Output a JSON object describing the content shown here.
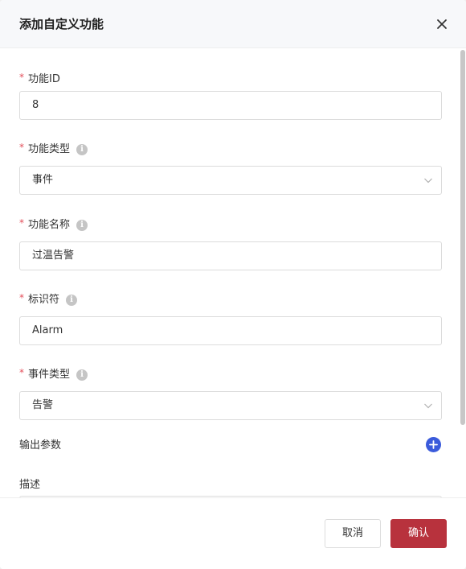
{
  "dialog": {
    "title": "添加自定义功能",
    "close_icon": "close-icon"
  },
  "form": {
    "required_mark": "*",
    "info_glyph": "i",
    "function_id": {
      "label": "功能ID",
      "value": "8"
    },
    "function_type": {
      "label": "功能类型",
      "value": "事件"
    },
    "function_name": {
      "label": "功能名称",
      "value": "过温告警"
    },
    "identifier": {
      "label": "标识符",
      "value": "Alarm"
    },
    "event_type": {
      "label": "事件类型",
      "value": "告警"
    },
    "output_params": {
      "label": "输出参数"
    },
    "description": {
      "label": "描述"
    }
  },
  "footer": {
    "cancel_label": "取消",
    "confirm_label": "确认"
  },
  "colors": {
    "primary": "#3b5bdb",
    "confirm": "#b8323d",
    "required": "#e34d59"
  }
}
